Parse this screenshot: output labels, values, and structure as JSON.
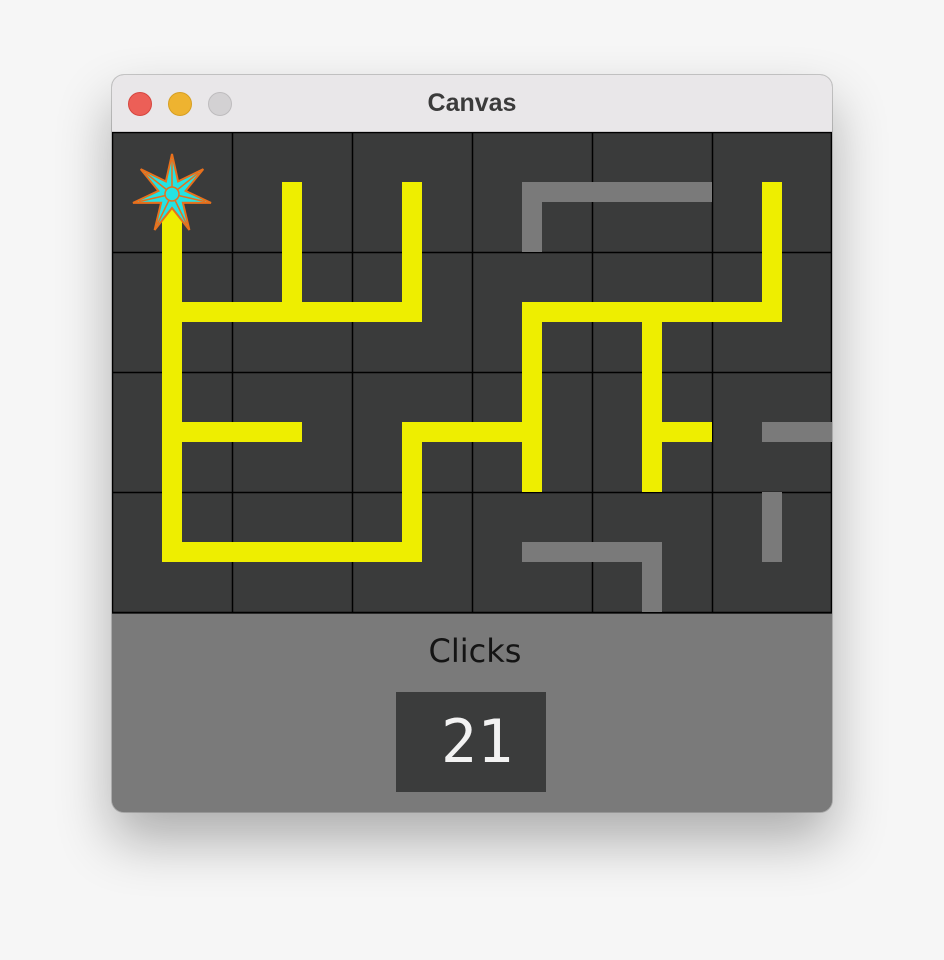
{
  "window": {
    "title": "Canvas",
    "traffic_lights": [
      "close",
      "minimize",
      "zoom"
    ]
  },
  "board": {
    "rows": 4,
    "cols": 6,
    "colors": {
      "background": "#3a3b3b",
      "grid": "#000000",
      "powered": "#eeee00",
      "unpowered": "#7a7a7a",
      "source_fill": "#24e3e3",
      "source_stroke": "#e8701c"
    },
    "source": {
      "row": 0,
      "col": 0,
      "icon": "star-icon"
    },
    "tiles": [
      [
        {
          "connections": [
            "S"
          ],
          "powered": true
        },
        {
          "connections": [
            "N",
            "S"
          ],
          "powered": true
        },
        {
          "connections": [
            "N",
            "S"
          ],
          "powered": true
        },
        {
          "connections": [
            "E",
            "S"
          ],
          "powered": false
        },
        {
          "connections": [
            "W",
            "E"
          ],
          "powered": false
        },
        {
          "connections": [
            "N",
            "S"
          ],
          "powered": true
        }
      ],
      [
        {
          "connections": [
            "N",
            "E",
            "S"
          ],
          "powered": true
        },
        {
          "connections": [
            "N",
            "W",
            "E"
          ],
          "powered": true
        },
        {
          "connections": [
            "N",
            "W"
          ],
          "powered": true
        },
        {
          "connections": [
            "E",
            "S"
          ],
          "powered": true
        },
        {
          "connections": [
            "W",
            "E",
            "S"
          ],
          "powered": true
        },
        {
          "connections": [
            "N",
            "W"
          ],
          "powered": true
        }
      ],
      [
        {
          "connections": [
            "N",
            "E",
            "S"
          ],
          "powered": true
        },
        {
          "connections": [
            "W"
          ],
          "powered": true
        },
        {
          "connections": [
            "E",
            "S"
          ],
          "powered": true
        },
        {
          "connections": [
            "N",
            "W",
            "S"
          ],
          "powered": true
        },
        {
          "connections": [
            "N",
            "E",
            "S"
          ],
          "powered": true
        },
        {
          "connections": [
            "E"
          ],
          "powered": false
        }
      ],
      [
        {
          "connections": [
            "N",
            "E"
          ],
          "powered": true
        },
        {
          "connections": [
            "W",
            "E"
          ],
          "powered": true
        },
        {
          "connections": [
            "N",
            "W"
          ],
          "powered": true
        },
        {
          "connections": [
            "E"
          ],
          "powered": false
        },
        {
          "connections": [
            "W",
            "S"
          ],
          "powered": false
        },
        {
          "connections": [
            "N"
          ],
          "powered": false
        }
      ]
    ]
  },
  "footer": {
    "label": "Clicks",
    "count": "21"
  }
}
